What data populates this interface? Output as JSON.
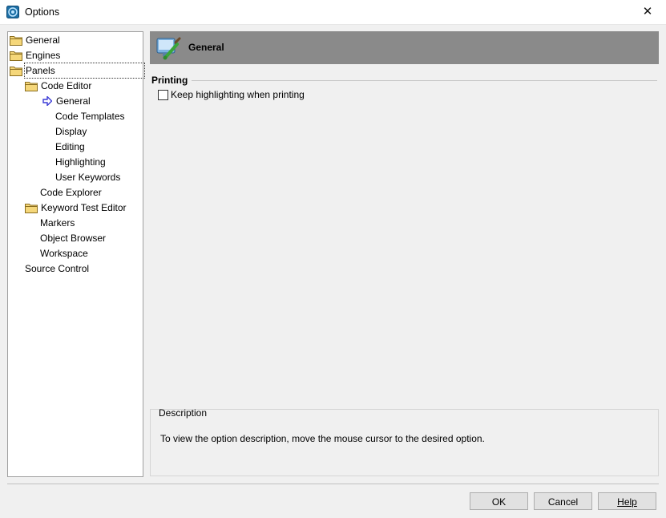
{
  "window": {
    "title": "Options",
    "close_glyph": "✕"
  },
  "tree": {
    "items": [
      {
        "label": "General",
        "level": 0,
        "icon": "folder-icon"
      },
      {
        "label": "Engines",
        "level": 0,
        "icon": "folder-icon"
      },
      {
        "label": "Panels",
        "level": 0,
        "icon": "folder-icon"
      },
      {
        "label": "Code Editor",
        "level": 1,
        "icon": "folder-icon"
      },
      {
        "label": "General",
        "level": 2,
        "icon": "arrow-right-icon"
      },
      {
        "label": "Code Templates",
        "level": 2,
        "icon": ""
      },
      {
        "label": "Display",
        "level": 2,
        "icon": ""
      },
      {
        "label": "Editing",
        "level": 2,
        "icon": ""
      },
      {
        "label": "Highlighting",
        "level": 2,
        "icon": ""
      },
      {
        "label": "User Keywords",
        "level": 2,
        "icon": ""
      },
      {
        "label": "Code Explorer",
        "level": 1,
        "icon": ""
      },
      {
        "label": "Keyword Test Editor",
        "level": 1,
        "icon": "folder-icon"
      },
      {
        "label": "Markers",
        "level": 1,
        "icon": ""
      },
      {
        "label": "Object Browser",
        "level": 1,
        "icon": ""
      },
      {
        "label": "Workspace",
        "level": 1,
        "icon": ""
      },
      {
        "label": "Source Control",
        "level": 0,
        "icon": ""
      }
    ]
  },
  "panel": {
    "header_title": "General",
    "group_title": "Printing",
    "checkbox_label": "Keep highlighting when printing",
    "checkbox_checked": false
  },
  "description": {
    "title": "Description",
    "text": "To view the option description, move the mouse cursor to the desired option."
  },
  "buttons": {
    "ok": "OK",
    "cancel": "Cancel",
    "help": "Help"
  },
  "colors": {
    "header_bg": "#8a8a8a",
    "arrow": "#3b3bd6",
    "folder": "#f5d77a"
  }
}
